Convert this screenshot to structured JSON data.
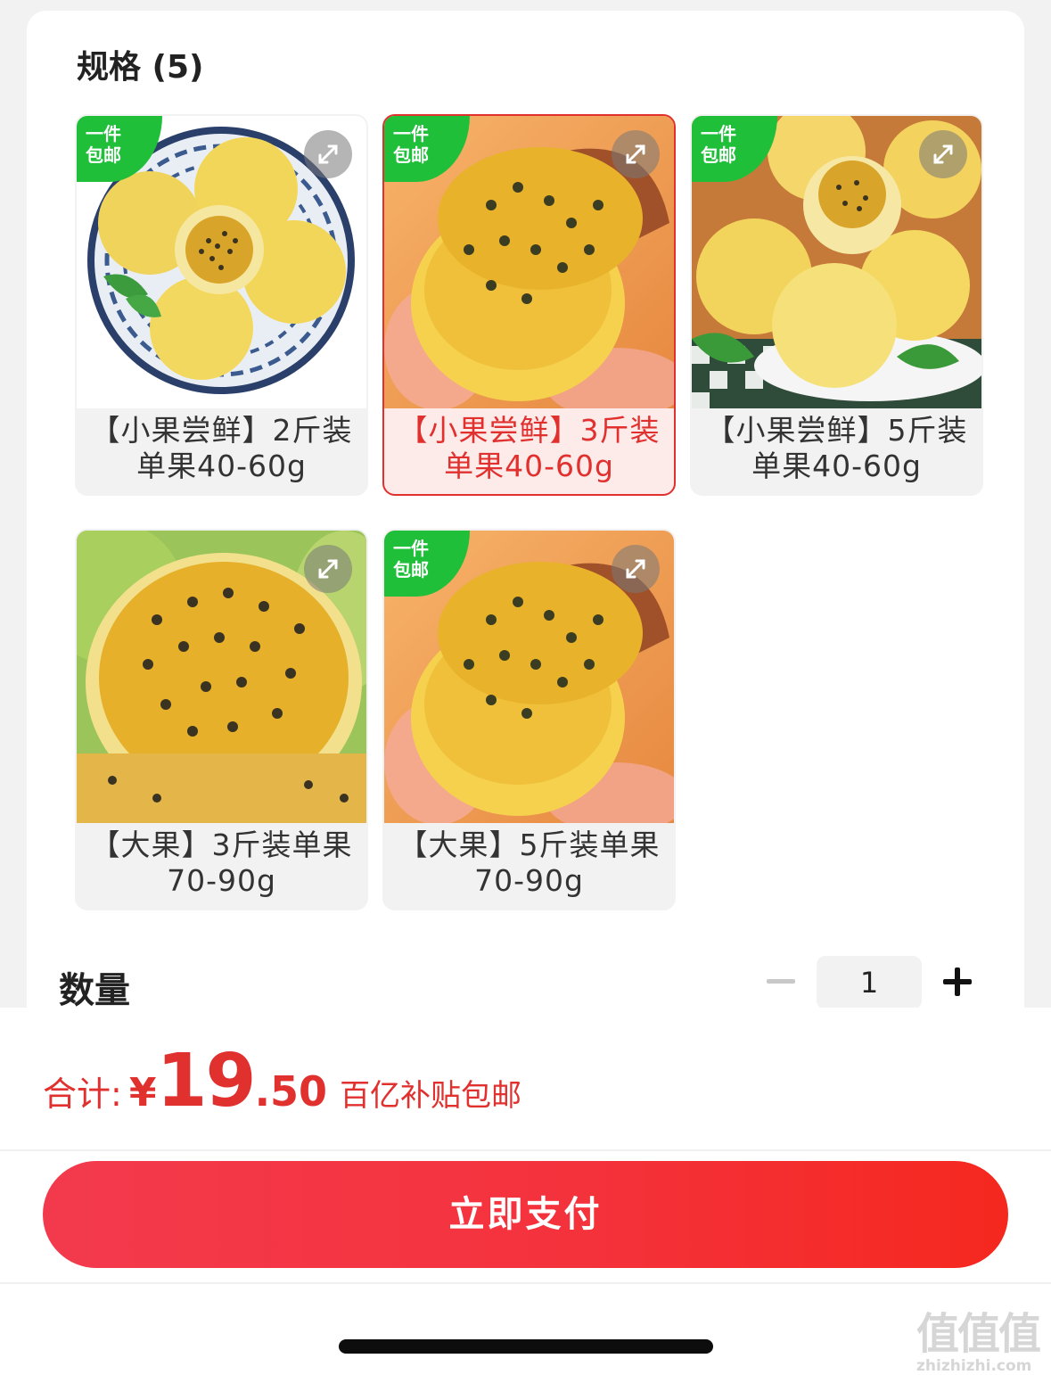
{
  "spec": {
    "title": "规格 (5)",
    "options": [
      {
        "badge": "一件\n包邮",
        "label": "【小果尝鲜】2斤装单果40-60g",
        "selected": false
      },
      {
        "badge": "一件\n包邮",
        "label": "【小果尝鲜】3斤装单果40-60g",
        "selected": true
      },
      {
        "badge": "一件\n包邮",
        "label": "【小果尝鲜】5斤装单果40-60g",
        "selected": false
      },
      {
        "badge": "",
        "label": "【大果】3斤装单果70-90g",
        "selected": false
      },
      {
        "badge": "一件\n包邮",
        "label": "【大果】5斤装单果70-90g",
        "selected": false
      }
    ]
  },
  "quantity": {
    "label": "数量",
    "value": "1",
    "minus_icon": "minus-icon",
    "plus_icon": "plus-icon"
  },
  "total": {
    "label": "合计:",
    "currency": "¥",
    "integer": "19",
    "decimal": ".50",
    "note": "百亿补贴包邮"
  },
  "pay_button": {
    "label": "立即支付"
  },
  "watermark": {
    "main": "值值值",
    "site": "zhizhizhi.com"
  },
  "colors": {
    "accent": "#e0312f",
    "badge": "#1fbf3a",
    "pay_start": "#f33a4d",
    "pay_end": "#f5281f"
  }
}
